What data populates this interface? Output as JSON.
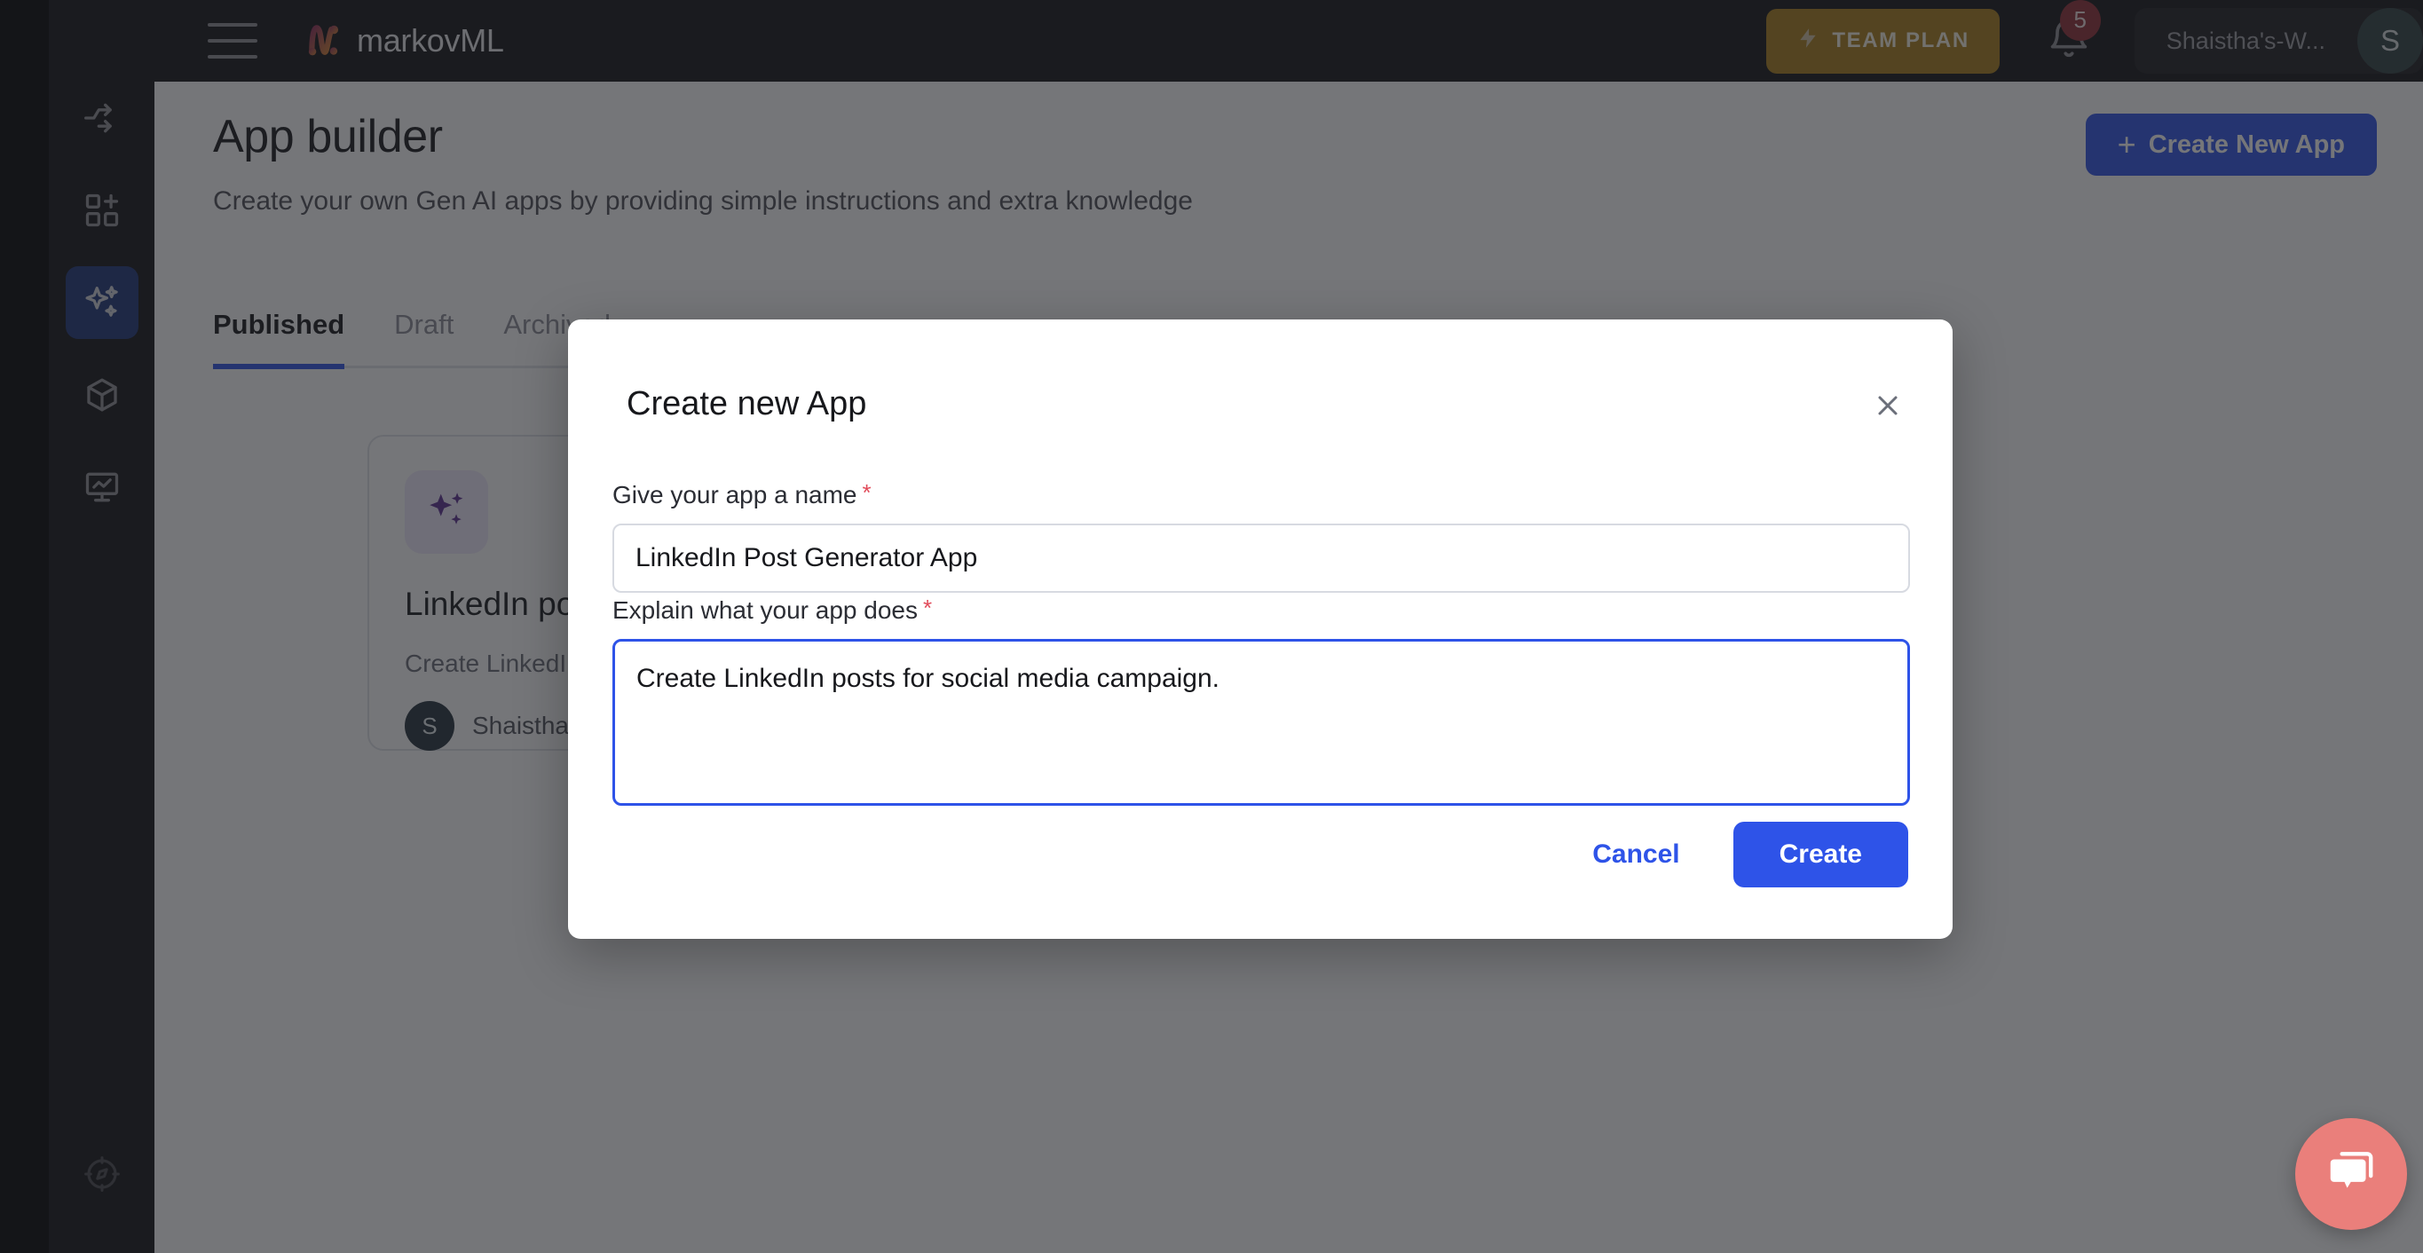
{
  "topbar": {
    "menu_icon": "hamburger-menu-icon",
    "brand": "markovML",
    "plan_badge": {
      "label": "TEAM PLAN",
      "icon": "lightning-bolt-icon",
      "color": "#a87d18"
    },
    "notifications": {
      "icon": "bell-icon",
      "count": "5",
      "badge_color": "#8e2a33"
    },
    "workspace": "Shaistha's-W...",
    "avatar_initial": "S"
  },
  "sidebar": {
    "items": [
      {
        "icon": "workflow-branch-icon",
        "name": "workflows",
        "active": false
      },
      {
        "icon": "grid-plus-icon",
        "name": "datasets",
        "active": false
      },
      {
        "icon": "sparkles-icon",
        "name": "app-builder",
        "active": true
      },
      {
        "icon": "cube-icon",
        "name": "models",
        "active": false
      },
      {
        "icon": "presentation-chart-icon",
        "name": "analytics",
        "active": false
      }
    ],
    "bottom_item": {
      "icon": "compass-icon",
      "name": "explore"
    },
    "active_color": "#1c3277"
  },
  "main": {
    "title": "App builder",
    "subtitle": "Create your own Gen AI apps by providing simple instructions and extra knowledge",
    "create_button": {
      "label": "Create New App",
      "icon": "plus-icon",
      "color": "#2e53e8"
    },
    "tabs": [
      {
        "label": "Published",
        "active": true
      },
      {
        "label": "Draft",
        "active": false
      },
      {
        "label": "Archived",
        "active": false
      }
    ],
    "cards": [
      {
        "icon": "sparkles-icon",
        "title": "LinkedIn post creator",
        "description": "Create LinkedIn posts for social",
        "author": "Shaistha Fathima",
        "author_initial": "S"
      }
    ]
  },
  "modal": {
    "title": "Create new App",
    "close_icon": "close-x-icon",
    "name_field": {
      "label": "Give your app a name",
      "required_marker": "*",
      "value": "LinkedIn Post Generator App",
      "placeholder": "Give your app a name"
    },
    "description_field": {
      "label": "Explain what your app does",
      "required_marker": "*",
      "value": "Create LinkedIn posts for social media campaign.",
      "placeholder": "Explain what your app does",
      "focused": true,
      "focus_color": "#2e53e8"
    },
    "cancel_label": "Cancel",
    "create_label": "Create"
  },
  "chat_widget": {
    "icon": "chat-bubbles-icon",
    "color": "#ea7f7b"
  }
}
